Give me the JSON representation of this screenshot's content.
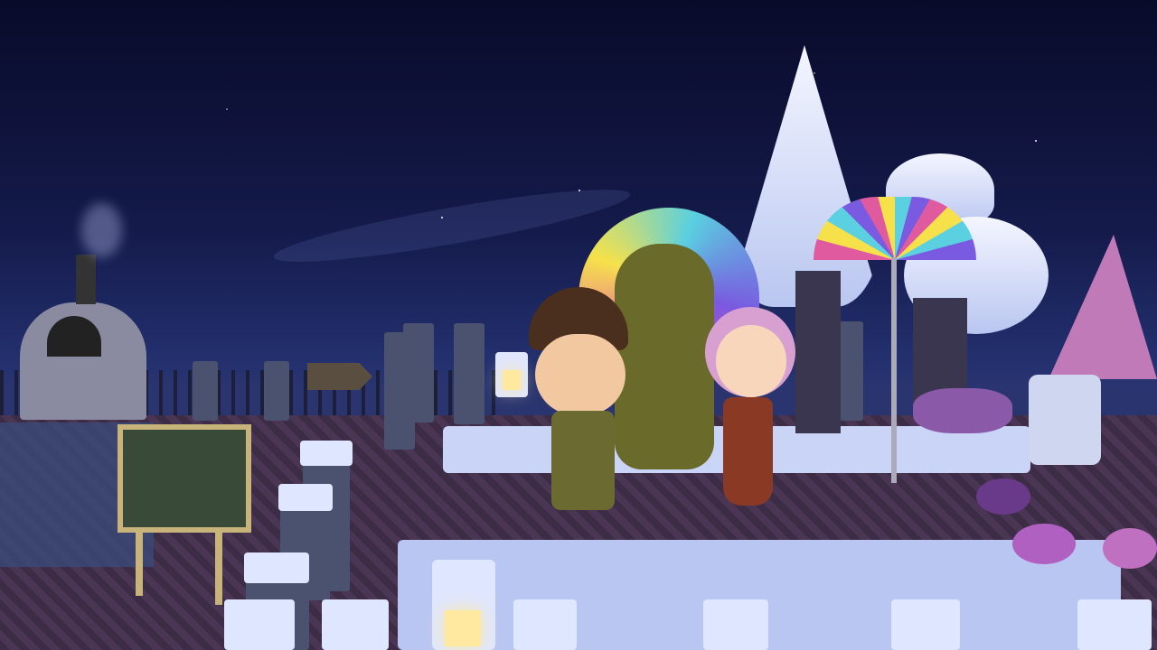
{
  "scene": {
    "time_of_day": "night",
    "colors": {
      "sky_top": "#090b2a",
      "sky_low": "#23306e",
      "brick_floor": "#3f2f4a",
      "snow": "#e8eeff",
      "tree_snow": "#dfe6ff",
      "lantern_glow": "#ffe9a0",
      "umbrella_stripes": [
        "#e05aa0",
        "#f6e14a",
        "#5ad0e0",
        "#7a5ae0"
      ],
      "peacock_pink": "#e040c0"
    },
    "icons": [
      "sign-icon",
      "lantern-icon",
      "easel-painting-icon",
      "peacock-statue-icon",
      "umbrella-icon",
      "stone-oven-icon"
    ]
  }
}
